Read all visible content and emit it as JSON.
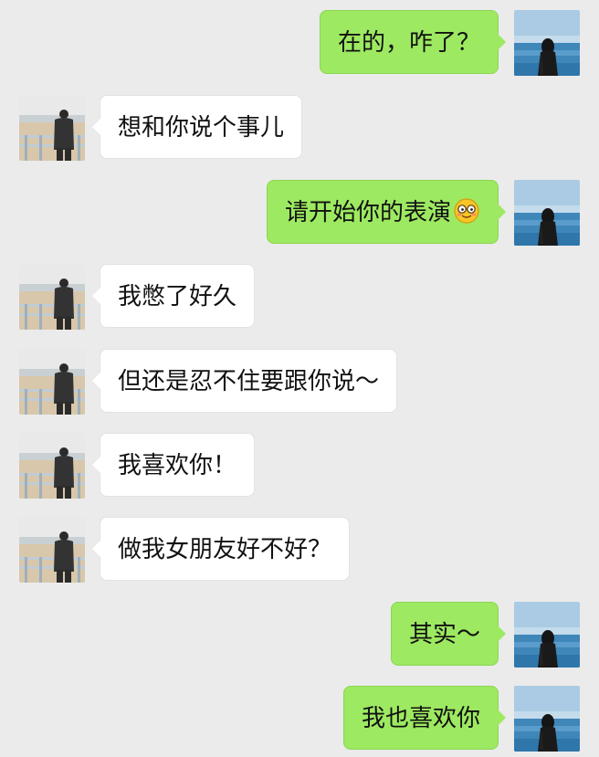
{
  "messages": [
    {
      "side": "right",
      "text": "在的，咋了？"
    },
    {
      "side": "left",
      "text": "想和你说个事儿"
    },
    {
      "side": "right",
      "text": "请开始你的表演",
      "emoji": "smiling-face-with-glasses-emoji"
    },
    {
      "side": "left",
      "text": "我憋了好久"
    },
    {
      "side": "left",
      "text": "但还是忍不住要跟你说～"
    },
    {
      "side": "left",
      "text": "我喜欢你！"
    },
    {
      "side": "left",
      "text": "做我女朋友好不好？"
    },
    {
      "side": "right",
      "text": "其实～"
    },
    {
      "side": "right",
      "text": "我也喜欢你"
    }
  ],
  "colors": {
    "background": "#ebebeb",
    "sent_bubble": "#9de961",
    "received_bubble": "#ffffff"
  },
  "avatars": {
    "me": "girl-by-sea-avatar",
    "other": "man-on-beach-avatar"
  }
}
